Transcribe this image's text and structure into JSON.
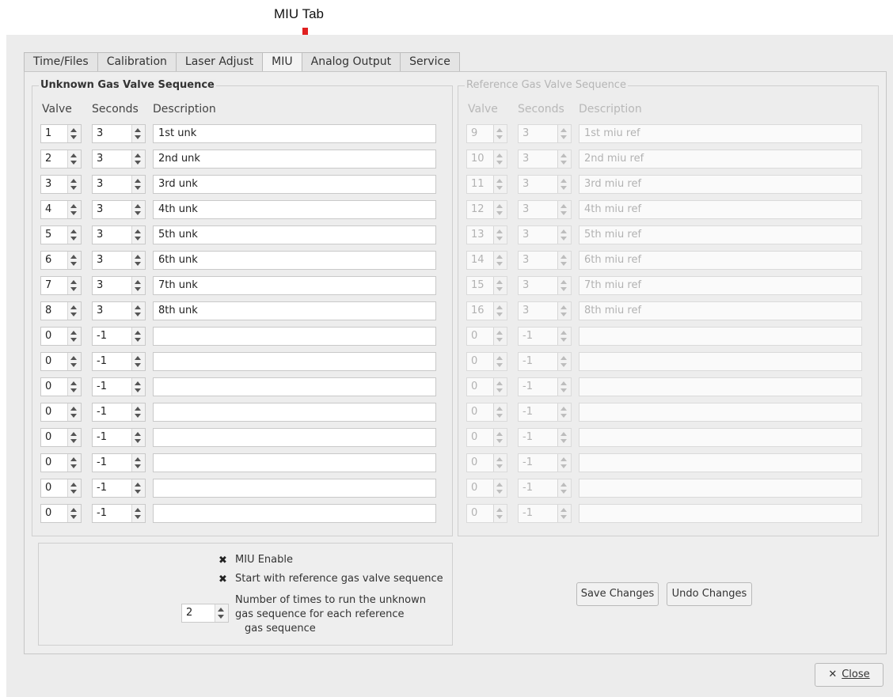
{
  "annotation": {
    "label": "MIU Tab"
  },
  "tabs": [
    {
      "label": "Time/Files"
    },
    {
      "label": "Calibration"
    },
    {
      "label": "Laser Adjust"
    },
    {
      "label": "MIU"
    },
    {
      "label": "Analog Output"
    },
    {
      "label": "Service"
    }
  ],
  "active_tab": "MIU",
  "unknown_group": {
    "title": "Unknown Gas Valve Sequence",
    "headers": {
      "valve": "Valve",
      "seconds": "Seconds",
      "description": "Description"
    },
    "rows": [
      {
        "valve": "1",
        "seconds": "3",
        "description": "1st unk"
      },
      {
        "valve": "2",
        "seconds": "3",
        "description": "2nd unk"
      },
      {
        "valve": "3",
        "seconds": "3",
        "description": "3rd unk"
      },
      {
        "valve": "4",
        "seconds": "3",
        "description": "4th unk"
      },
      {
        "valve": "5",
        "seconds": "3",
        "description": "5th unk"
      },
      {
        "valve": "6",
        "seconds": "3",
        "description": "6th unk"
      },
      {
        "valve": "7",
        "seconds": "3",
        "description": "7th unk"
      },
      {
        "valve": "8",
        "seconds": "3",
        "description": "8th unk"
      },
      {
        "valve": "0",
        "seconds": "-1",
        "description": ""
      },
      {
        "valve": "0",
        "seconds": "-1",
        "description": ""
      },
      {
        "valve": "0",
        "seconds": "-1",
        "description": ""
      },
      {
        "valve": "0",
        "seconds": "-1",
        "description": ""
      },
      {
        "valve": "0",
        "seconds": "-1",
        "description": ""
      },
      {
        "valve": "0",
        "seconds": "-1",
        "description": ""
      },
      {
        "valve": "0",
        "seconds": "-1",
        "description": ""
      },
      {
        "valve": "0",
        "seconds": "-1",
        "description": ""
      }
    ]
  },
  "reference_group": {
    "title": "Reference Gas Valve Sequence",
    "headers": {
      "valve": "Valve",
      "seconds": "Seconds",
      "description": "Description"
    },
    "rows": [
      {
        "valve": "9",
        "seconds": "3",
        "description": "1st miu ref"
      },
      {
        "valve": "10",
        "seconds": "3",
        "description": "2nd miu ref"
      },
      {
        "valve": "11",
        "seconds": "3",
        "description": "3rd miu ref"
      },
      {
        "valve": "12",
        "seconds": "3",
        "description": "4th miu ref"
      },
      {
        "valve": "13",
        "seconds": "3",
        "description": "5th miu ref"
      },
      {
        "valve": "14",
        "seconds": "3",
        "description": "6th miu ref"
      },
      {
        "valve": "15",
        "seconds": "3",
        "description": "7th miu ref"
      },
      {
        "valve": "16",
        "seconds": "3",
        "description": "8th miu ref"
      },
      {
        "valve": "0",
        "seconds": "-1",
        "description": ""
      },
      {
        "valve": "0",
        "seconds": "-1",
        "description": ""
      },
      {
        "valve": "0",
        "seconds": "-1",
        "description": ""
      },
      {
        "valve": "0",
        "seconds": "-1",
        "description": ""
      },
      {
        "valve": "0",
        "seconds": "-1",
        "description": ""
      },
      {
        "valve": "0",
        "seconds": "-1",
        "description": ""
      },
      {
        "valve": "0",
        "seconds": "-1",
        "description": ""
      },
      {
        "valve": "0",
        "seconds": "-1",
        "description": ""
      }
    ]
  },
  "options": {
    "miu_enable": {
      "label": "MIU Enable",
      "checked": true
    },
    "start_with_reference": {
      "label": "Start with reference gas valve sequence",
      "checked": true
    },
    "run_count": {
      "value": "2",
      "label_lines": [
        "Number of times to run the unknown",
        "gas sequence for each reference",
        "gas sequence"
      ]
    }
  },
  "buttons": {
    "save": "Save Changes",
    "undo": "Undo Changes",
    "close": "Close",
    "close_icon": "close-x-icon"
  }
}
